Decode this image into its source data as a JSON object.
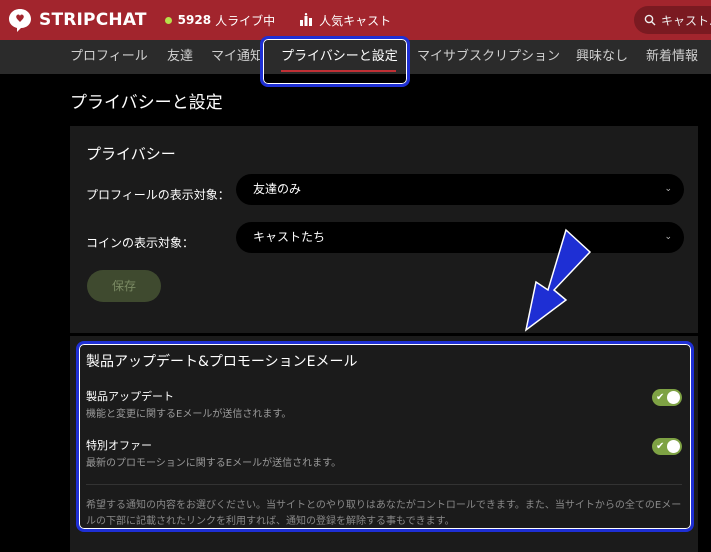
{
  "header": {
    "brand": "STRIPCHAT",
    "live_count": "5928",
    "live_label": "人ライブ中",
    "popular_label": "人気キャスト",
    "search_placeholder": "キャスト..."
  },
  "nav": {
    "items": [
      {
        "label": "プロフィール"
      },
      {
        "label": "友達"
      },
      {
        "label": "マイ通知"
      },
      {
        "label": "プライバシーと設定"
      },
      {
        "label": "マイサブスクリプション"
      },
      {
        "label": "興味なし"
      },
      {
        "label": "新着情報"
      }
    ],
    "active_index": 3
  },
  "page": {
    "title": "プライバシーと設定"
  },
  "privacy": {
    "title": "プライバシー",
    "profile_visibility": {
      "label": "プロフィールの表示対象：",
      "value": "友達のみ"
    },
    "coin_visibility": {
      "label": "コインの表示対象：",
      "value": "キャストたち"
    },
    "save_label": "保存"
  },
  "notifications": {
    "title": "製品アップデート&プロモーションEメール",
    "options": [
      {
        "title": "製品アップデート",
        "description": "機能と変更に関するEメールが送信されます。",
        "enabled": true
      },
      {
        "title": "特別オファー",
        "description": "最新のプロモーションに関するEメールが送信されます。",
        "enabled": true
      }
    ],
    "footnote": "希望する通知の内容をお選びください。当サイトとのやり取りはあなたがコントロールできます。また、当サイトからの全てのEメールの下部に記載されたリンクを利用すれば、通知の登録を解除する事もできます。"
  },
  "colors": {
    "header_bg": "#a2252d",
    "accent_toggle": "#7ea244",
    "highlight": "#1e2fd4"
  },
  "icons": {
    "logo": "stripchat-logo-icon",
    "popular": "ranking-icon",
    "search": "search-icon",
    "select_chevron": "chevron-down-icon",
    "annotation": "arrow-down-left-icon"
  }
}
